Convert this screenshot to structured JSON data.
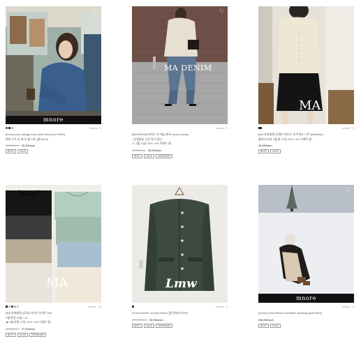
{
  "products": [
    {
      "brand_logo": "mnore",
      "swatches": [
        "#8b5a3c",
        "#2a2a2a",
        "#c9b79c"
      ],
      "review": "review : 0",
      "name_lines": [
        "[mnore] sori vintage mod cable knit (wool 100%)",
        "원버 스트 라 캐 이 블 니트 (울100%)"
      ],
      "price_old": "59,000won",
      "price_new": "25,000won",
      "tags": [
        "BEST",
        "SALE"
      ]
    },
    {
      "brand_logo": "MA DENIM",
      "swatches": [],
      "review": "review : 0",
      "name_lines": [
        "[MA DENIM] 와이드 진 데님 팬츠 (denim pants)",
        "* 당일발송  신상 특가 할인",
        "※ 7월 15일 10%~ 5% 이벤트 중!"
      ],
      "price_old": "49,000won",
      "price_new": "26,900won",
      "tags": [
        "BEST",
        "SALE",
        "NEWMADE"
      ]
    },
    {
      "brand_logo": "MA",
      "swatches": [
        "#222222"
      ],
      "review": "review : 0",
      "name_lines": [
        "[MA 자체제작] 투웨이 라운드 넥 트위드 니트 (Bellstory)",
        "퀄리티 보장 7월 중 17일 10%~ 5% 이벤트 중!"
      ],
      "price_old": "",
      "price_new": "35,500won",
      "tags": [
        "BEST",
        "SALE"
      ]
    },
    {
      "brand_logo": "MA",
      "swatches": [
        "#111111",
        "#e8e6e0",
        "#4a4a4a",
        "#a7c4b5",
        "#d8cfc0"
      ],
      "review": "review : 11",
      "name_lines": [
        "[MA 자체제작] [무료] 가디건 라이트 knit",
        "7월 한정 15일 / 12",
        "★ 5월 한정 17일 10%~ 5% 이벤트 중!"
      ],
      "price_old": "45,000won",
      "price_new": "27,900won",
      "tags": [
        "BEST",
        "SALE",
        "NEWMADE"
      ]
    },
    {
      "brand_logo": "Lmw",
      "swatches": [
        "#2e3a30"
      ],
      "review": "review : 3",
      "name_lines": [
        "[Lmw] tweeter crochet tweed (울 알파카 80%)"
      ],
      "price_old": "109,000won",
      "price_new": "55,900won",
      "tags": [
        "BEST",
        "SALE",
        "NEWMADE"
      ]
    },
    {
      "brand_logo": "mnore",
      "swatches": [],
      "review": "review : 0",
      "name_lines": [
        "[mnore] mina fleece reversible mustang (wool 80%)"
      ],
      "price_old": "",
      "price_new": "266,000won",
      "tags": [
        "BEST",
        "SALE"
      ]
    }
  ]
}
